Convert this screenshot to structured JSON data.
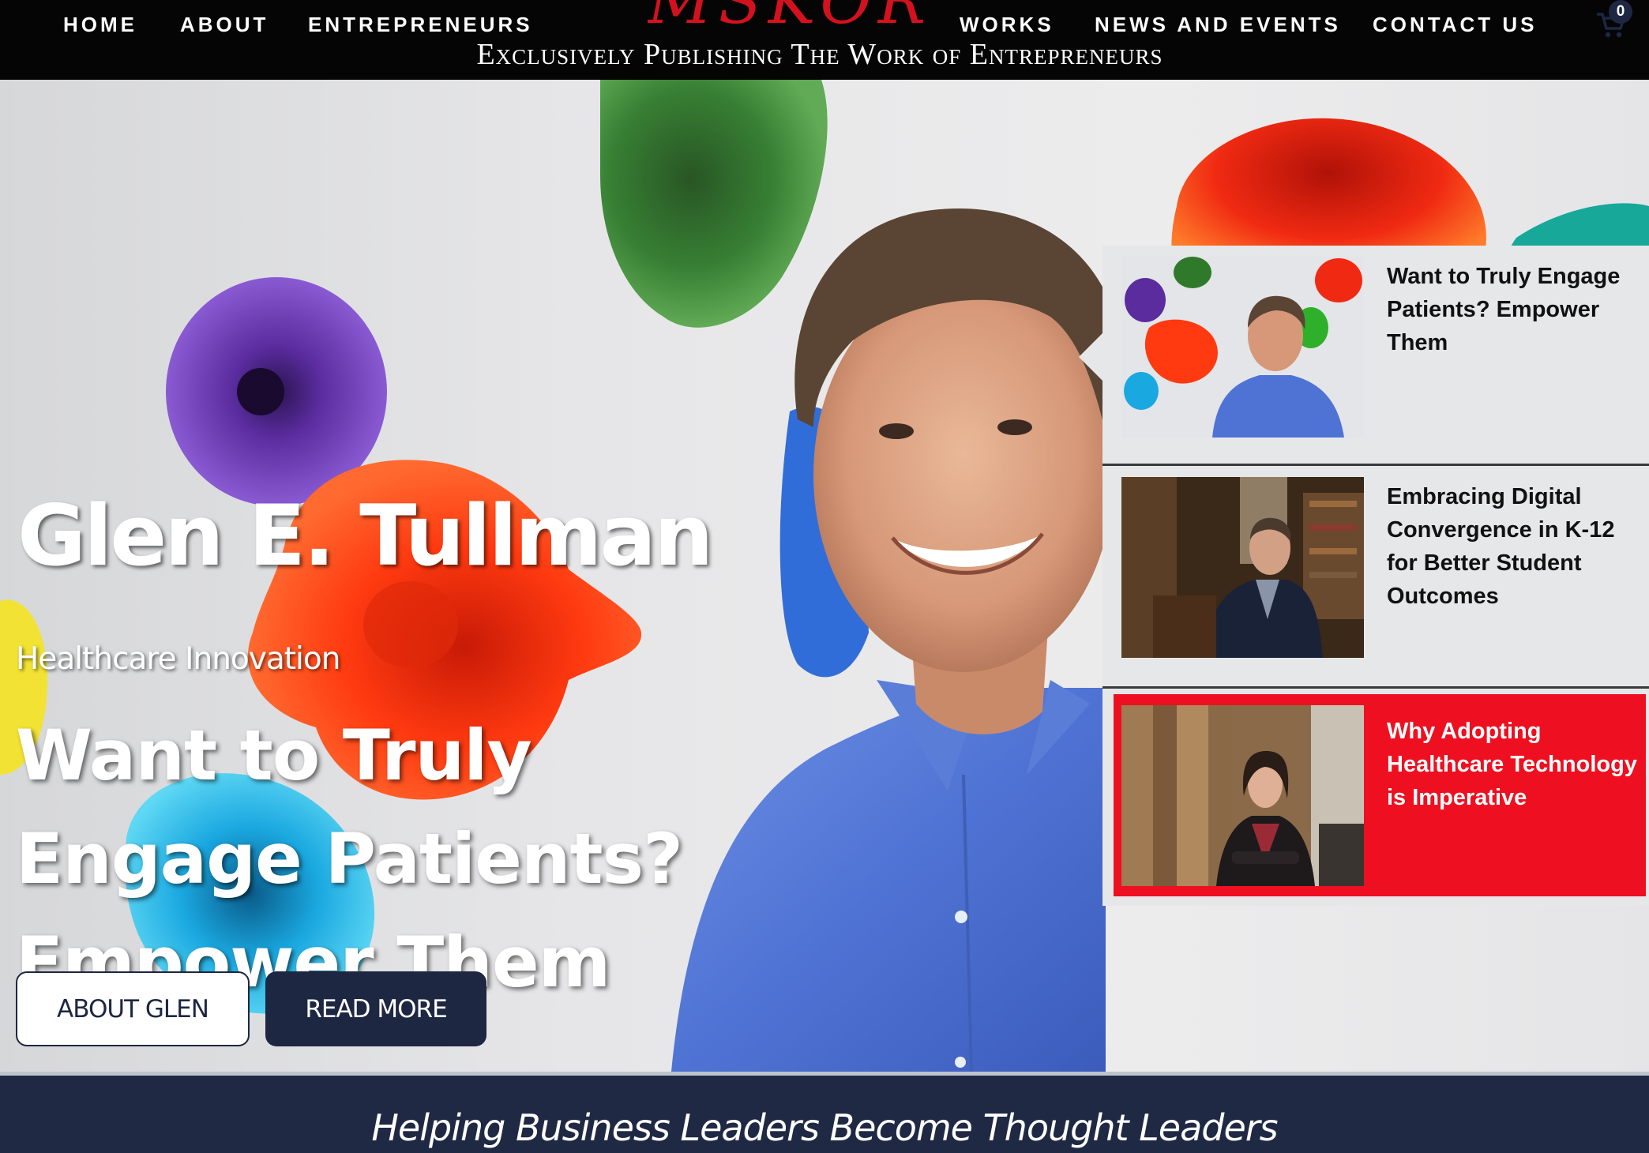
{
  "nav": {
    "home": "HOME",
    "about": "ABOUT",
    "entrepreneurs": "ENTREPRENEURS",
    "works": "WORKS",
    "news_events": "NEWS AND EVENTS",
    "contact": "CONTACT US"
  },
  "brand": {
    "logo_text": "MSKOR",
    "tagline": "Exclusively Publishing The Work of Entrepreneurs",
    "accent_color": "#d4111e"
  },
  "cart": {
    "icon": "shopping-cart-icon",
    "count": "0"
  },
  "hero": {
    "name": "Glen E. Tullman",
    "category": "Healthcare Innovation",
    "headline": "Want to Truly Engage Patients? Empower Them",
    "about_button": "ABOUT GLEN",
    "read_button": "READ MORE",
    "button_color": "#1d2742"
  },
  "articles": [
    {
      "title": "Want to Truly Engage Patients? Empower Them",
      "active": false
    },
    {
      "title": "Embracing Digital Convergence in K-12 for Better Student Outcomes",
      "active": false
    },
    {
      "title": "Why Adopting Healthcare Technology is Imperative",
      "active": true
    }
  ],
  "active_color": "#ee1020",
  "banner": {
    "text": "Helping Business Leaders Become Thought Leaders",
    "color": "#1f2944"
  }
}
